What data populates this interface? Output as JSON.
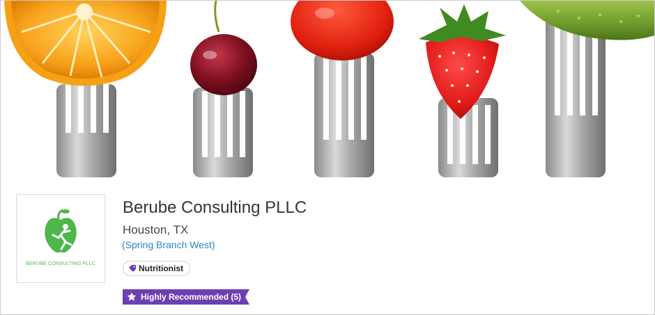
{
  "business": {
    "name": "Berube Consulting PLLC",
    "location": "Houston, TX",
    "neighborhood": "(Spring Branch West)",
    "logo_text": "BERUBE CONSULTING PLLC"
  },
  "category_tag": {
    "label": "Nutritionist",
    "icon": "tag-icon"
  },
  "recommendation_badge": {
    "label": "Highly Recommended (5)",
    "icon": "star-icon",
    "color": "#6d3fb3"
  },
  "banner": {
    "image": "fruits-on-forks-photo"
  },
  "colors": {
    "accent_link": "#2a86c7",
    "logo_green": "#4fb64a"
  }
}
